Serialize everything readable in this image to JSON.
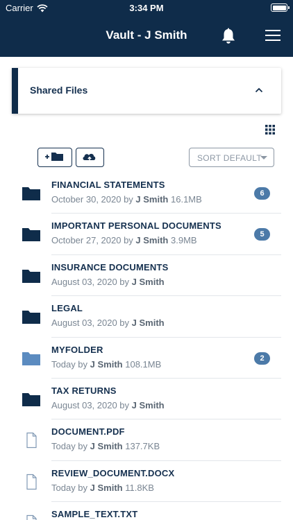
{
  "status_bar": {
    "carrier": "Carrier",
    "time": "3:34 PM"
  },
  "nav": {
    "title": "Vault - J Smith",
    "icons": [
      "bell-icon",
      "hamburger-menu-icon"
    ]
  },
  "shared_section": {
    "label": "Shared Files",
    "expanded": true
  },
  "toolbar": {
    "view_toggle": "grid-icon",
    "add_folder": "add-folder-icon",
    "upload": "cloud-upload-icon",
    "sort_label": "SORT DEFAULT"
  },
  "colors": {
    "navy": "#0f2c4a",
    "text": "#15304f",
    "badge": "#4c7aa8",
    "meta": "#7a8693",
    "light_folder": "#5b8bc0"
  },
  "items": [
    {
      "name": "FINANCIAL STATEMENTS",
      "date": "October 30, 2020 by ",
      "owner": "J Smith",
      "size": " 16.1MB",
      "count": "6",
      "kind": "folder"
    },
    {
      "name": "IMPORTANT PERSONAL DOCUMENTS",
      "date": "October 27, 2020 by ",
      "owner": "J Smith",
      "size": " 3.9MB",
      "count": "5",
      "kind": "folder"
    },
    {
      "name": "INSURANCE DOCUMENTS",
      "date": "August 03, 2020 by ",
      "owner": "J Smith",
      "size": "",
      "count": "",
      "kind": "folder"
    },
    {
      "name": "LEGAL",
      "date": "August 03, 2020 by ",
      "owner": "J Smith",
      "size": "",
      "count": "",
      "kind": "folder"
    },
    {
      "name": "MYFOLDER",
      "date": "Today by ",
      "owner": "J Smith",
      "size": " 108.1MB",
      "count": "2",
      "kind": "folder-light"
    },
    {
      "name": "TAX RETURNS",
      "date": "August 03, 2020 by ",
      "owner": "J Smith",
      "size": "",
      "count": "",
      "kind": "folder"
    },
    {
      "name": "DOCUMENT.PDF",
      "date": "Today by ",
      "owner": "J Smith",
      "size": " 137.7KB",
      "count": "",
      "kind": "file"
    },
    {
      "name": "REVIEW_DOCUMENT.DOCX",
      "date": "Today by ",
      "owner": "J Smith",
      "size": " 11.8KB",
      "count": "",
      "kind": "file"
    },
    {
      "name": "SAMPLE_TEXT.TXT",
      "date": "",
      "owner": "",
      "size": "",
      "count": "",
      "kind": "file"
    }
  ]
}
